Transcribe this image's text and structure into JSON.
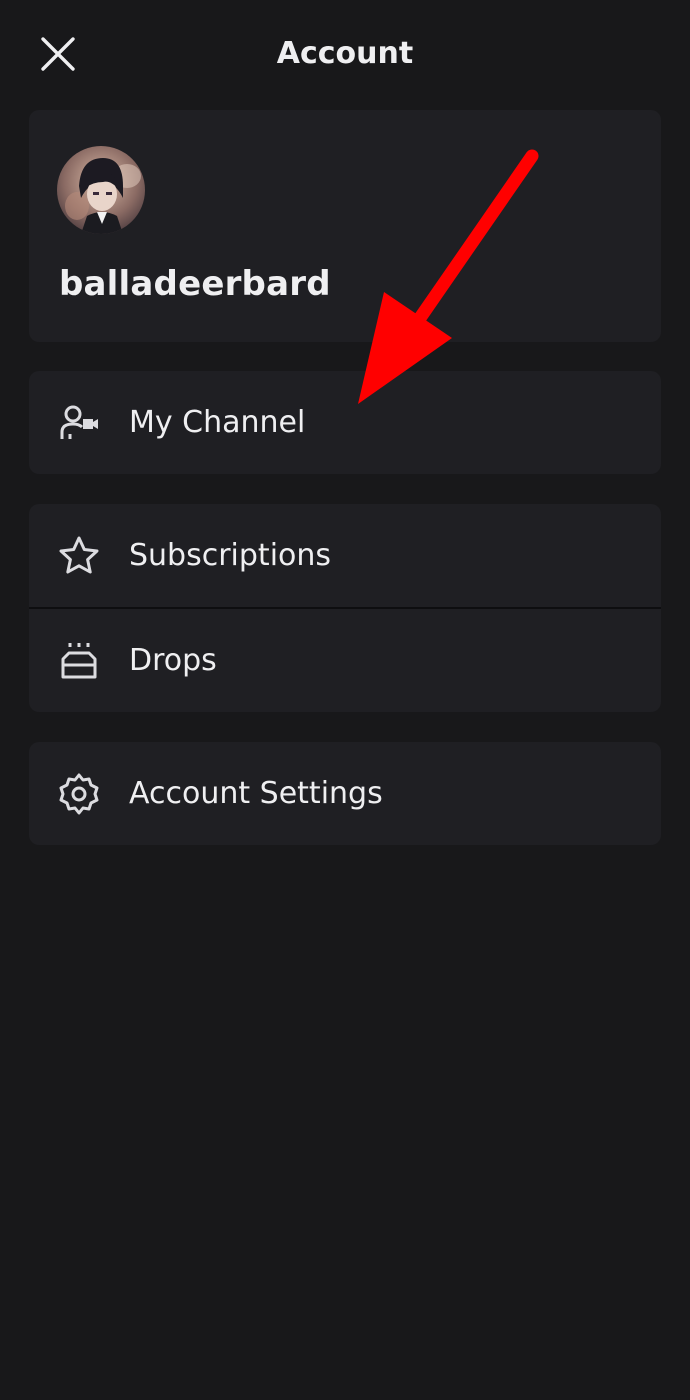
{
  "header": {
    "title": "Account",
    "close_icon": "close-icon"
  },
  "profile": {
    "username": "balladeerbard",
    "avatar_icon": "avatar"
  },
  "menu": {
    "my_channel": {
      "label": "My Channel",
      "icon": "user-camera-icon"
    },
    "subscriptions": {
      "label": "Subscriptions",
      "icon": "star-icon"
    },
    "drops": {
      "label": "Drops",
      "icon": "chest-icon"
    },
    "account_settings": {
      "label": "Account Settings",
      "icon": "gear-icon"
    }
  },
  "annotation": {
    "arrow_color": "#ff0000",
    "arrow_icon": "red-pointer-arrow"
  },
  "colors": {
    "background": "#18181a",
    "card": "#1f1f23",
    "text": "#efeff1",
    "icon": "#dcdce0"
  }
}
